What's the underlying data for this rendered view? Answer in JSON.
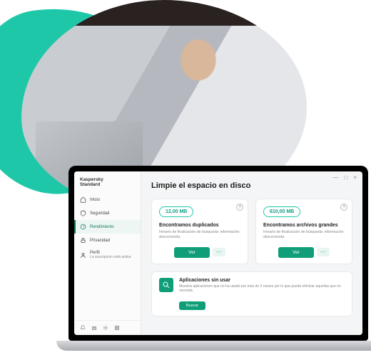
{
  "brand": {
    "line1": "Kaspersky",
    "line2": "Standard"
  },
  "sidebar": {
    "items": [
      {
        "label": "Inicio"
      },
      {
        "label": "Seguridad"
      },
      {
        "label": "Rendimiento"
      },
      {
        "label": "Privacidad"
      },
      {
        "label": "Perfil",
        "sub": "La suscripción está activa"
      }
    ]
  },
  "window": {
    "min": "—",
    "max": "□",
    "close": "×"
  },
  "main": {
    "title": "Limpie el espacio en disco",
    "cards": [
      {
        "metric": "12,00 MB",
        "title": "Encontramos duplicados",
        "desc": "Horario de finalización de búsqueda: información desconocida.",
        "action": "Ver"
      },
      {
        "metric": "610,00 MB",
        "title": "Encontramos archivos grandes",
        "desc": "Horario de finalización de búsqueda: información desconocida.",
        "action": "Ver"
      }
    ],
    "unused": {
      "title": "Aplicaciones sin usar",
      "desc": "Muestra aplicaciones que no ha usado por más de 3 meses por lo que puede eliminar aquellas que no necesita.",
      "action": "Buscar"
    },
    "more": "⋯",
    "help": "?"
  }
}
